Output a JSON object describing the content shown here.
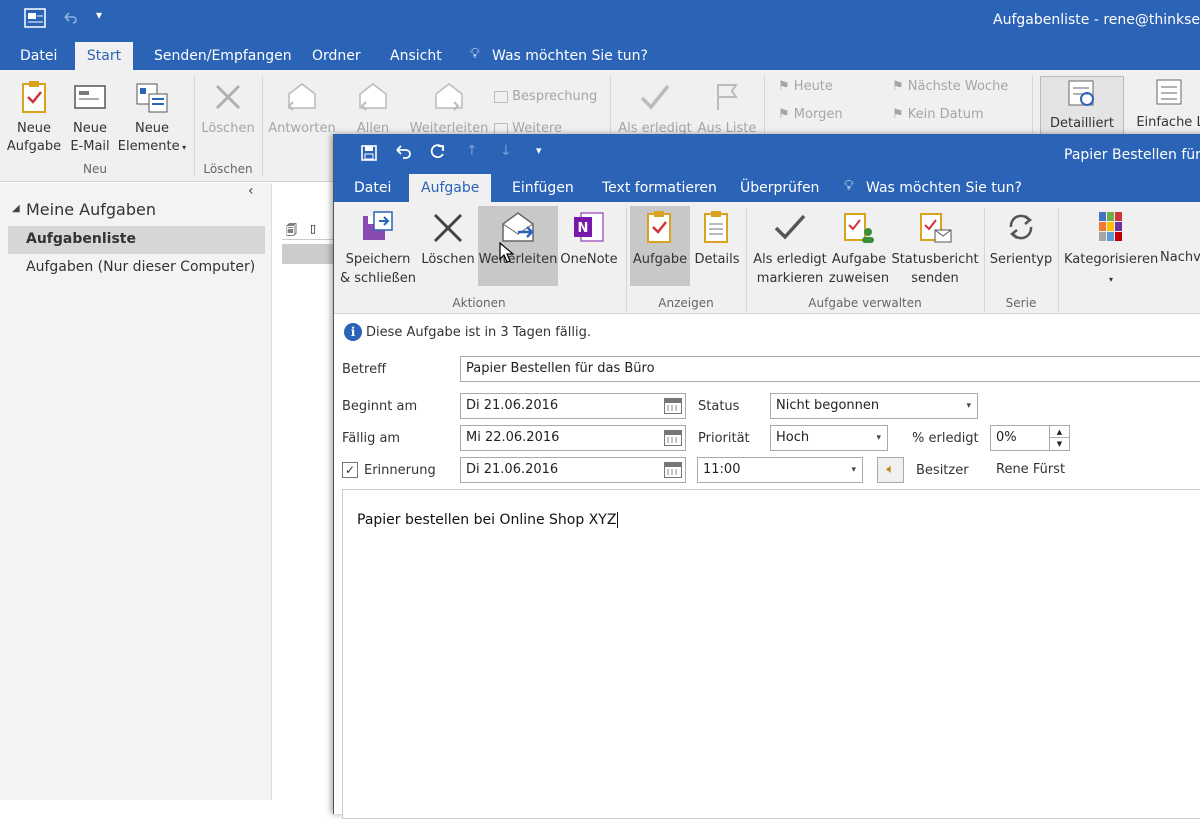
{
  "main": {
    "title": "Aufgabenliste - rene@thinksecret",
    "tabs": [
      "Datei",
      "Start",
      "Senden/Empfangen",
      "Ordner",
      "Ansicht"
    ],
    "tell_me": "Was möchten Sie tun?",
    "ribbon": {
      "new_task": [
        "Neue",
        "Aufgabe"
      ],
      "new_email": [
        "Neue",
        "E-Mail"
      ],
      "new_items": [
        "Neue",
        "Elemente"
      ],
      "delete": "Löschen",
      "reply": "Antworten",
      "reply_all": "Allen",
      "forward": "Weiterleiten",
      "meeting": "Besprechung",
      "more": "Weitere",
      "mark_complete": "Als erledigt",
      "remove_list": "Aus Liste",
      "today": "Heute",
      "tomorrow": "Morgen",
      "next_week": "Nächste Woche",
      "no_date": "Kein Datum",
      "detailed": "Detailliert",
      "simple": "Einfache L",
      "group_new": "Neu",
      "group_delete": "Löschen"
    },
    "nav": {
      "header": "Meine Aufgaben",
      "items": [
        "Aufgabenliste",
        "Aufgaben (Nur dieser Computer)"
      ]
    }
  },
  "task": {
    "title": "Papier Bestellen für da",
    "tabs": [
      "Datei",
      "Aufgabe",
      "Einfügen",
      "Text formatieren",
      "Überprüfen"
    ],
    "tell_me": "Was möchten Sie tun?",
    "ribbon": {
      "save_close": [
        "Speichern",
        "& schließen"
      ],
      "delete": "Löschen",
      "forward": "Weiterleiten",
      "onenote": "OneNote",
      "task": "Aufgabe",
      "details": "Details",
      "mark_complete": [
        "Als erledigt",
        "markieren"
      ],
      "assign": [
        "Aufgabe",
        "zuweisen"
      ],
      "status_report": [
        "Statusbericht",
        "senden"
      ],
      "recurrence": "Serientyp",
      "categorize": "Kategorisieren",
      "followup": "Nachve",
      "group_actions": "Aktionen",
      "group_show": "Anzeigen",
      "group_manage": "Aufgabe verwalten",
      "group_series": "Serie"
    },
    "info": "Diese Aufgabe ist in 3 Tagen fällig.",
    "form": {
      "subject_label": "Betreff",
      "subject": "Papier Bestellen für das Büro",
      "start_label": "Beginnt am",
      "start": "Di 21.06.2016",
      "due_label": "Fällig am",
      "due": "Mi 22.06.2016",
      "reminder_label": "Erinnerung",
      "reminder_date": "Di 21.06.2016",
      "reminder_time": "11:00",
      "status_label": "Status",
      "status": "Nicht begonnen",
      "priority_label": "Priorität",
      "priority": "Hoch",
      "percent_label": "% erledigt",
      "percent": "0%",
      "owner_label": "Besitzer",
      "owner": "Rene Fürst"
    },
    "body": "Papier bestellen bei Online Shop XYZ"
  }
}
